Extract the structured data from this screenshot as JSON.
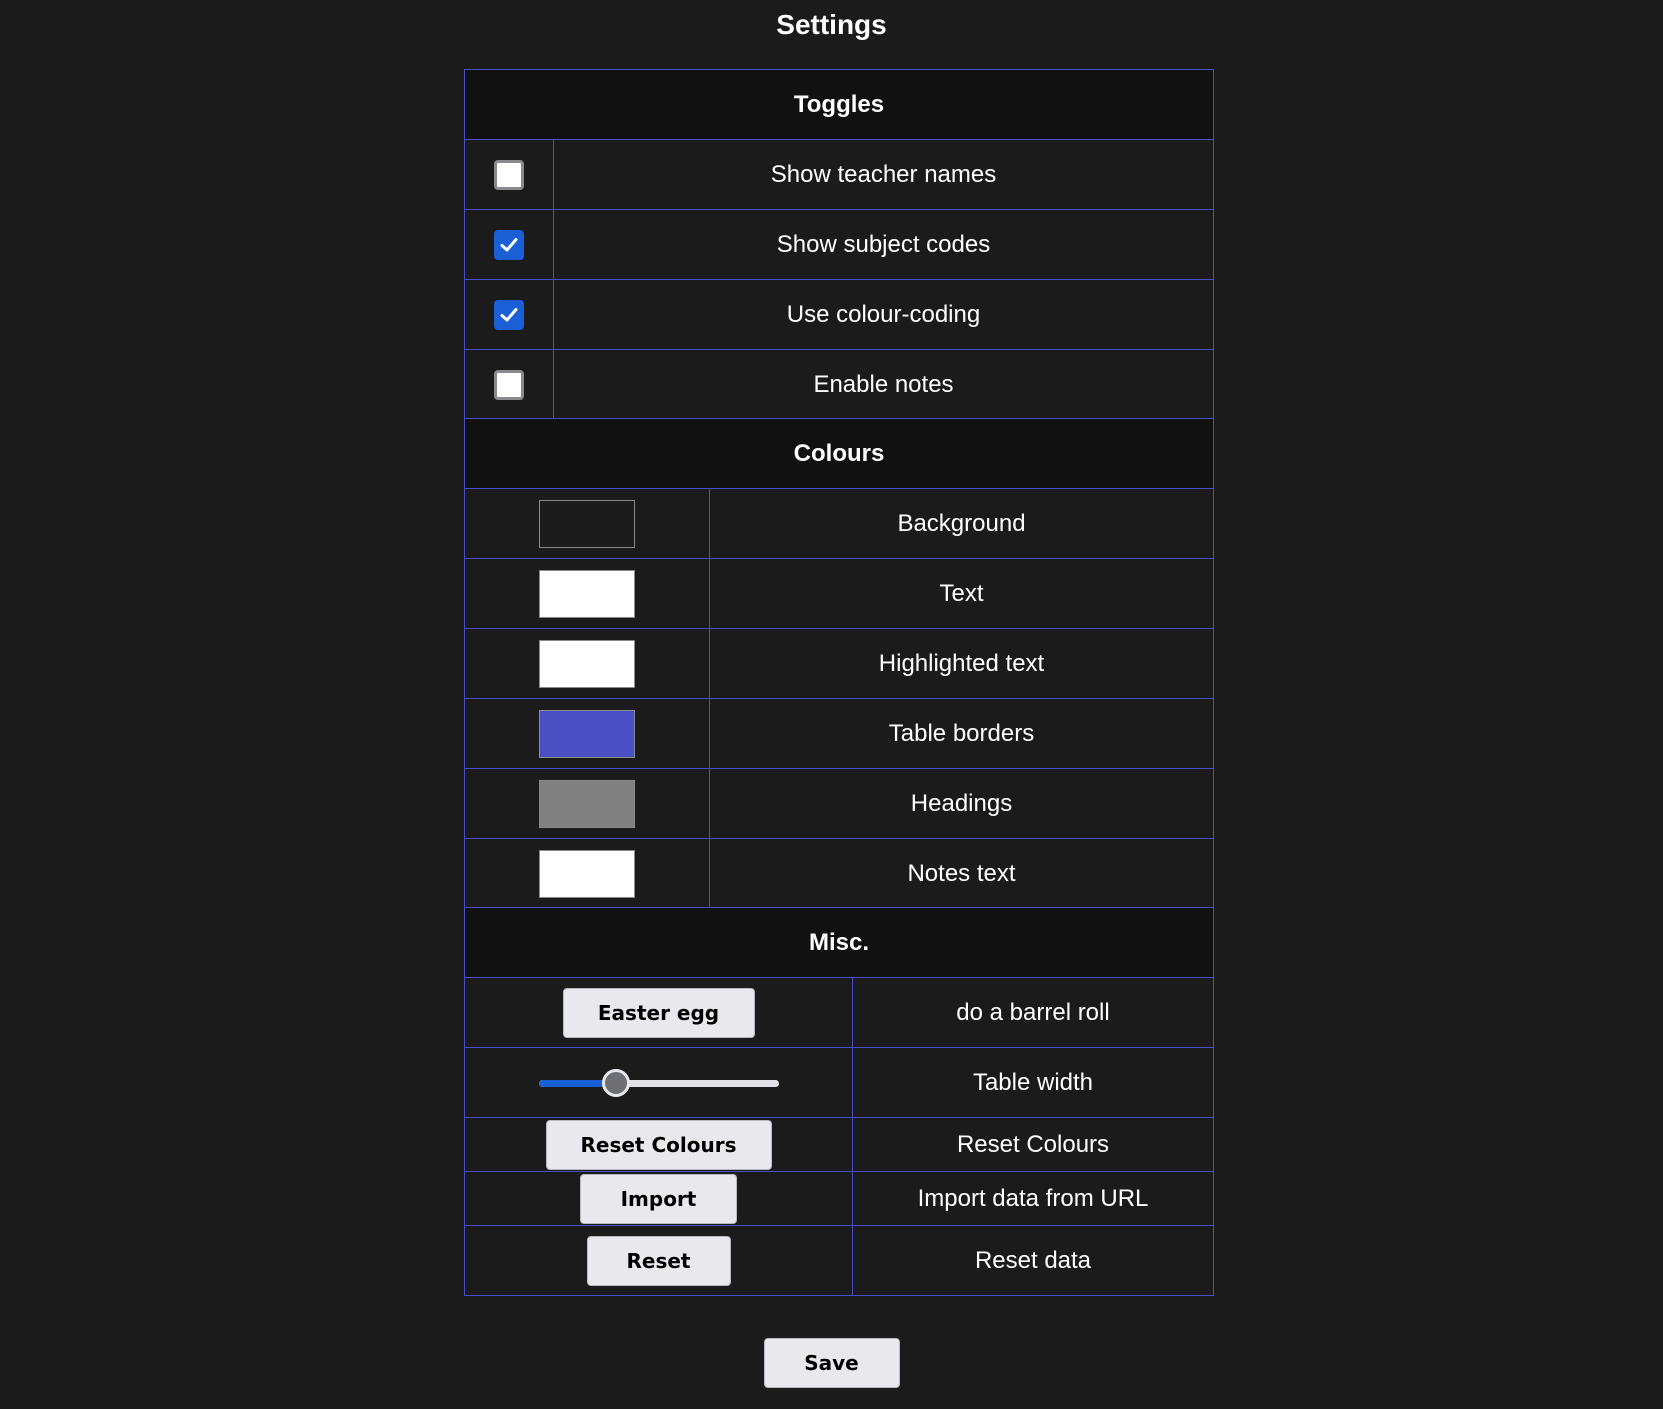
{
  "page": {
    "title": "Settings",
    "background_color": "#1b1b1c",
    "border_color": "#4a50c4"
  },
  "toggles": {
    "heading": "Toggles",
    "items": [
      {
        "label": "Show teacher names",
        "checked": false
      },
      {
        "label": "Show subject codes",
        "checked": true
      },
      {
        "label": "Use colour-coding",
        "checked": true
      },
      {
        "label": "Enable notes",
        "checked": false
      }
    ]
  },
  "colours": {
    "heading": "Colours",
    "items": [
      {
        "label": "Background",
        "color": "#1b1b1c"
      },
      {
        "label": "Text",
        "color": "#ffffff"
      },
      {
        "label": "Highlighted text",
        "color": "#ffffff"
      },
      {
        "label": "Table borders",
        "color": "#4a50c4"
      },
      {
        "label": "Headings",
        "color": "#808080"
      },
      {
        "label": "Notes text",
        "color": "#ffffff"
      }
    ]
  },
  "misc": {
    "heading": "Misc.",
    "easter_egg": {
      "button": "Easter egg",
      "label": "do a barrel roll"
    },
    "table_width": {
      "label": "Table width",
      "value_fraction": 0.32
    },
    "reset_colours": {
      "button": "Reset Colours",
      "label": "Reset Colours"
    },
    "import": {
      "button": "Import",
      "label": "Import data from URL"
    },
    "reset": {
      "button": "Reset",
      "label": "Reset data"
    }
  },
  "save_button": "Save"
}
